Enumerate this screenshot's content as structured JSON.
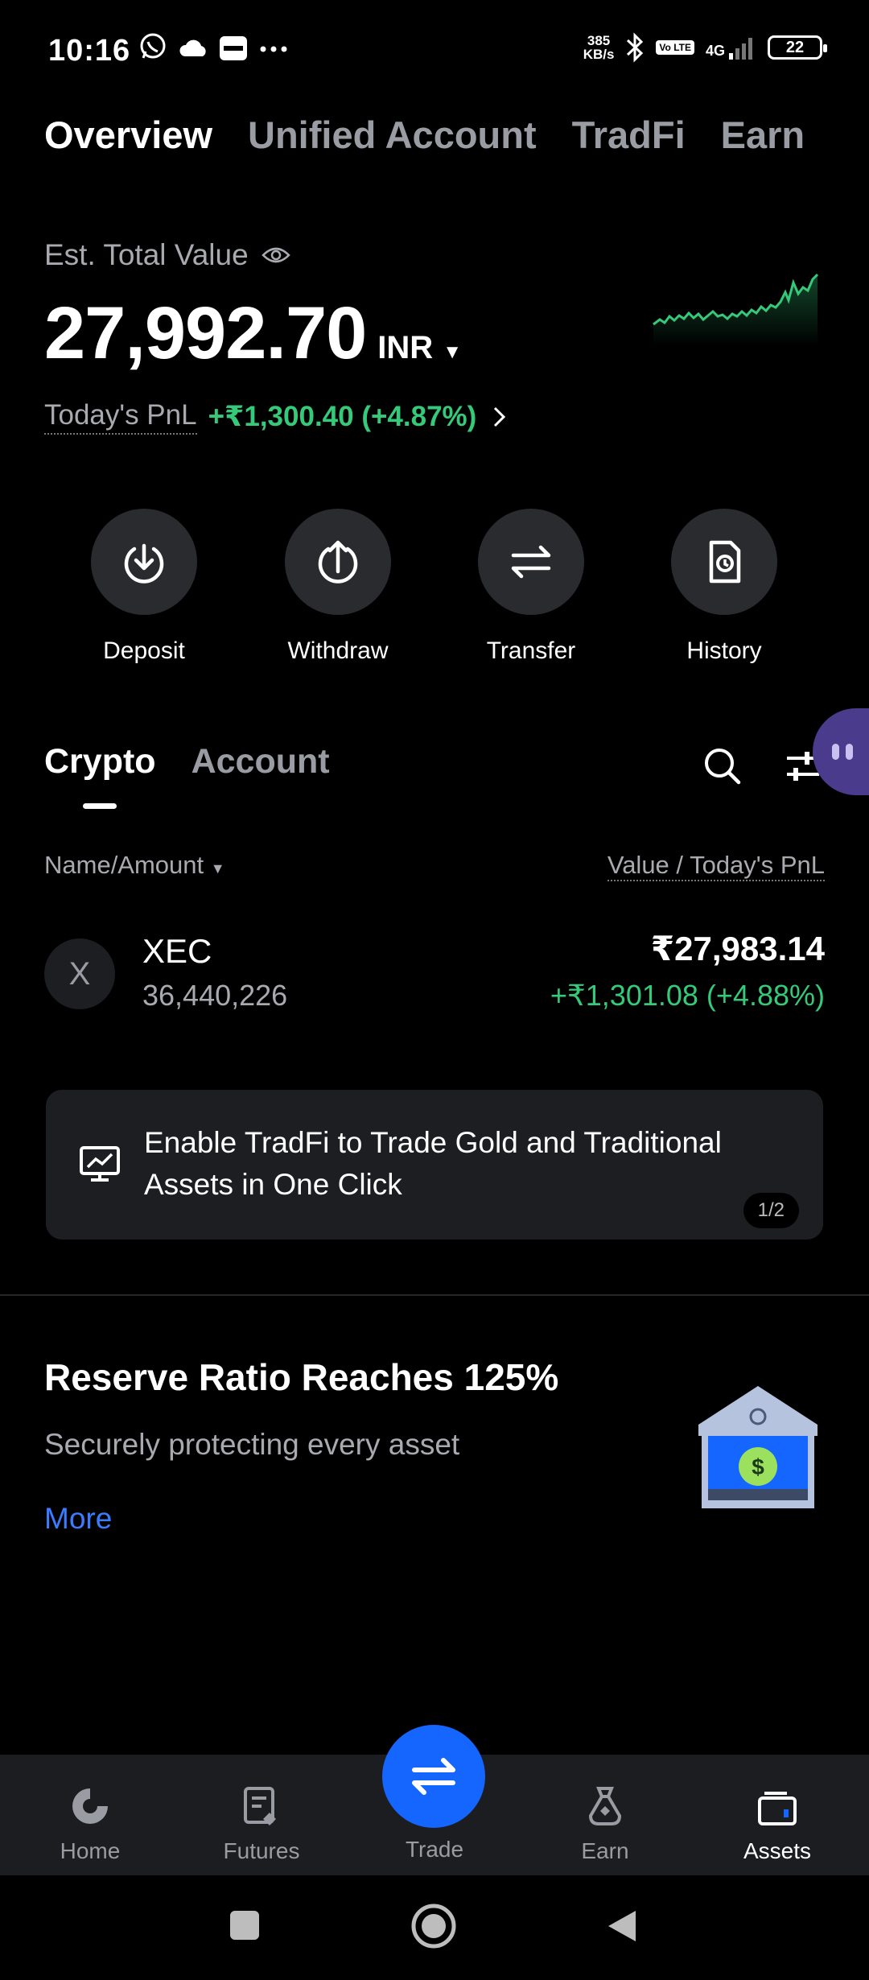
{
  "status_bar": {
    "time": "10:16",
    "net_speed_value": "385",
    "net_speed_unit": "KB/s",
    "network": "4G",
    "volte": "Vo LTE",
    "battery": "22",
    "icons": [
      "whatsapp-icon",
      "cloud-icon",
      "paytm-icon",
      "more-dots-icon",
      "bluetooth-icon",
      "signal-icon"
    ]
  },
  "top_tabs": [
    "Overview",
    "Unified Account",
    "TradFi",
    "Earn"
  ],
  "summary": {
    "label": "Est. Total Value",
    "value": "27,992.70",
    "currency": "INR",
    "pnl_label": "Today's PnL",
    "pnl_value": "+₹1,300.40 (+4.87%)",
    "sparkline_color": "#35c97a"
  },
  "actions": [
    {
      "label": "Deposit",
      "icon": "deposit-icon"
    },
    {
      "label": "Withdraw",
      "icon": "withdraw-icon"
    },
    {
      "label": "Transfer",
      "icon": "transfer-icon"
    },
    {
      "label": "History",
      "icon": "history-icon"
    }
  ],
  "sub_tabs": [
    "Crypto",
    "Account"
  ],
  "list_header": {
    "left": "Name/Amount",
    "right": "Value / Today's PnL"
  },
  "assets": [
    {
      "logo": "X",
      "symbol": "XEC",
      "amount": "36,440,226",
      "value": "₹27,983.14",
      "pnl": "+₹1,301.08 (+4.88%)"
    }
  ],
  "banner": {
    "text": "Enable TradFi to Trade Gold and Traditional Assets in One Click",
    "page": "1/2"
  },
  "reserve": {
    "title": "Reserve Ratio Reaches 125%",
    "subtitle": "Securely protecting every asset",
    "more": "More",
    "coin_symbol": "$"
  },
  "bottom_nav": [
    {
      "label": "Home",
      "icon": "home-icon"
    },
    {
      "label": "Futures",
      "icon": "futures-icon"
    },
    {
      "label": "Trade",
      "icon": "trade-icon"
    },
    {
      "label": "Earn",
      "icon": "earn-icon"
    },
    {
      "label": "Assets",
      "icon": "assets-icon",
      "active": true
    }
  ],
  "colors": {
    "accent_green": "#35c97a",
    "accent_blue": "#1565ff",
    "link_blue": "#3b7cff",
    "background": "#000000"
  }
}
